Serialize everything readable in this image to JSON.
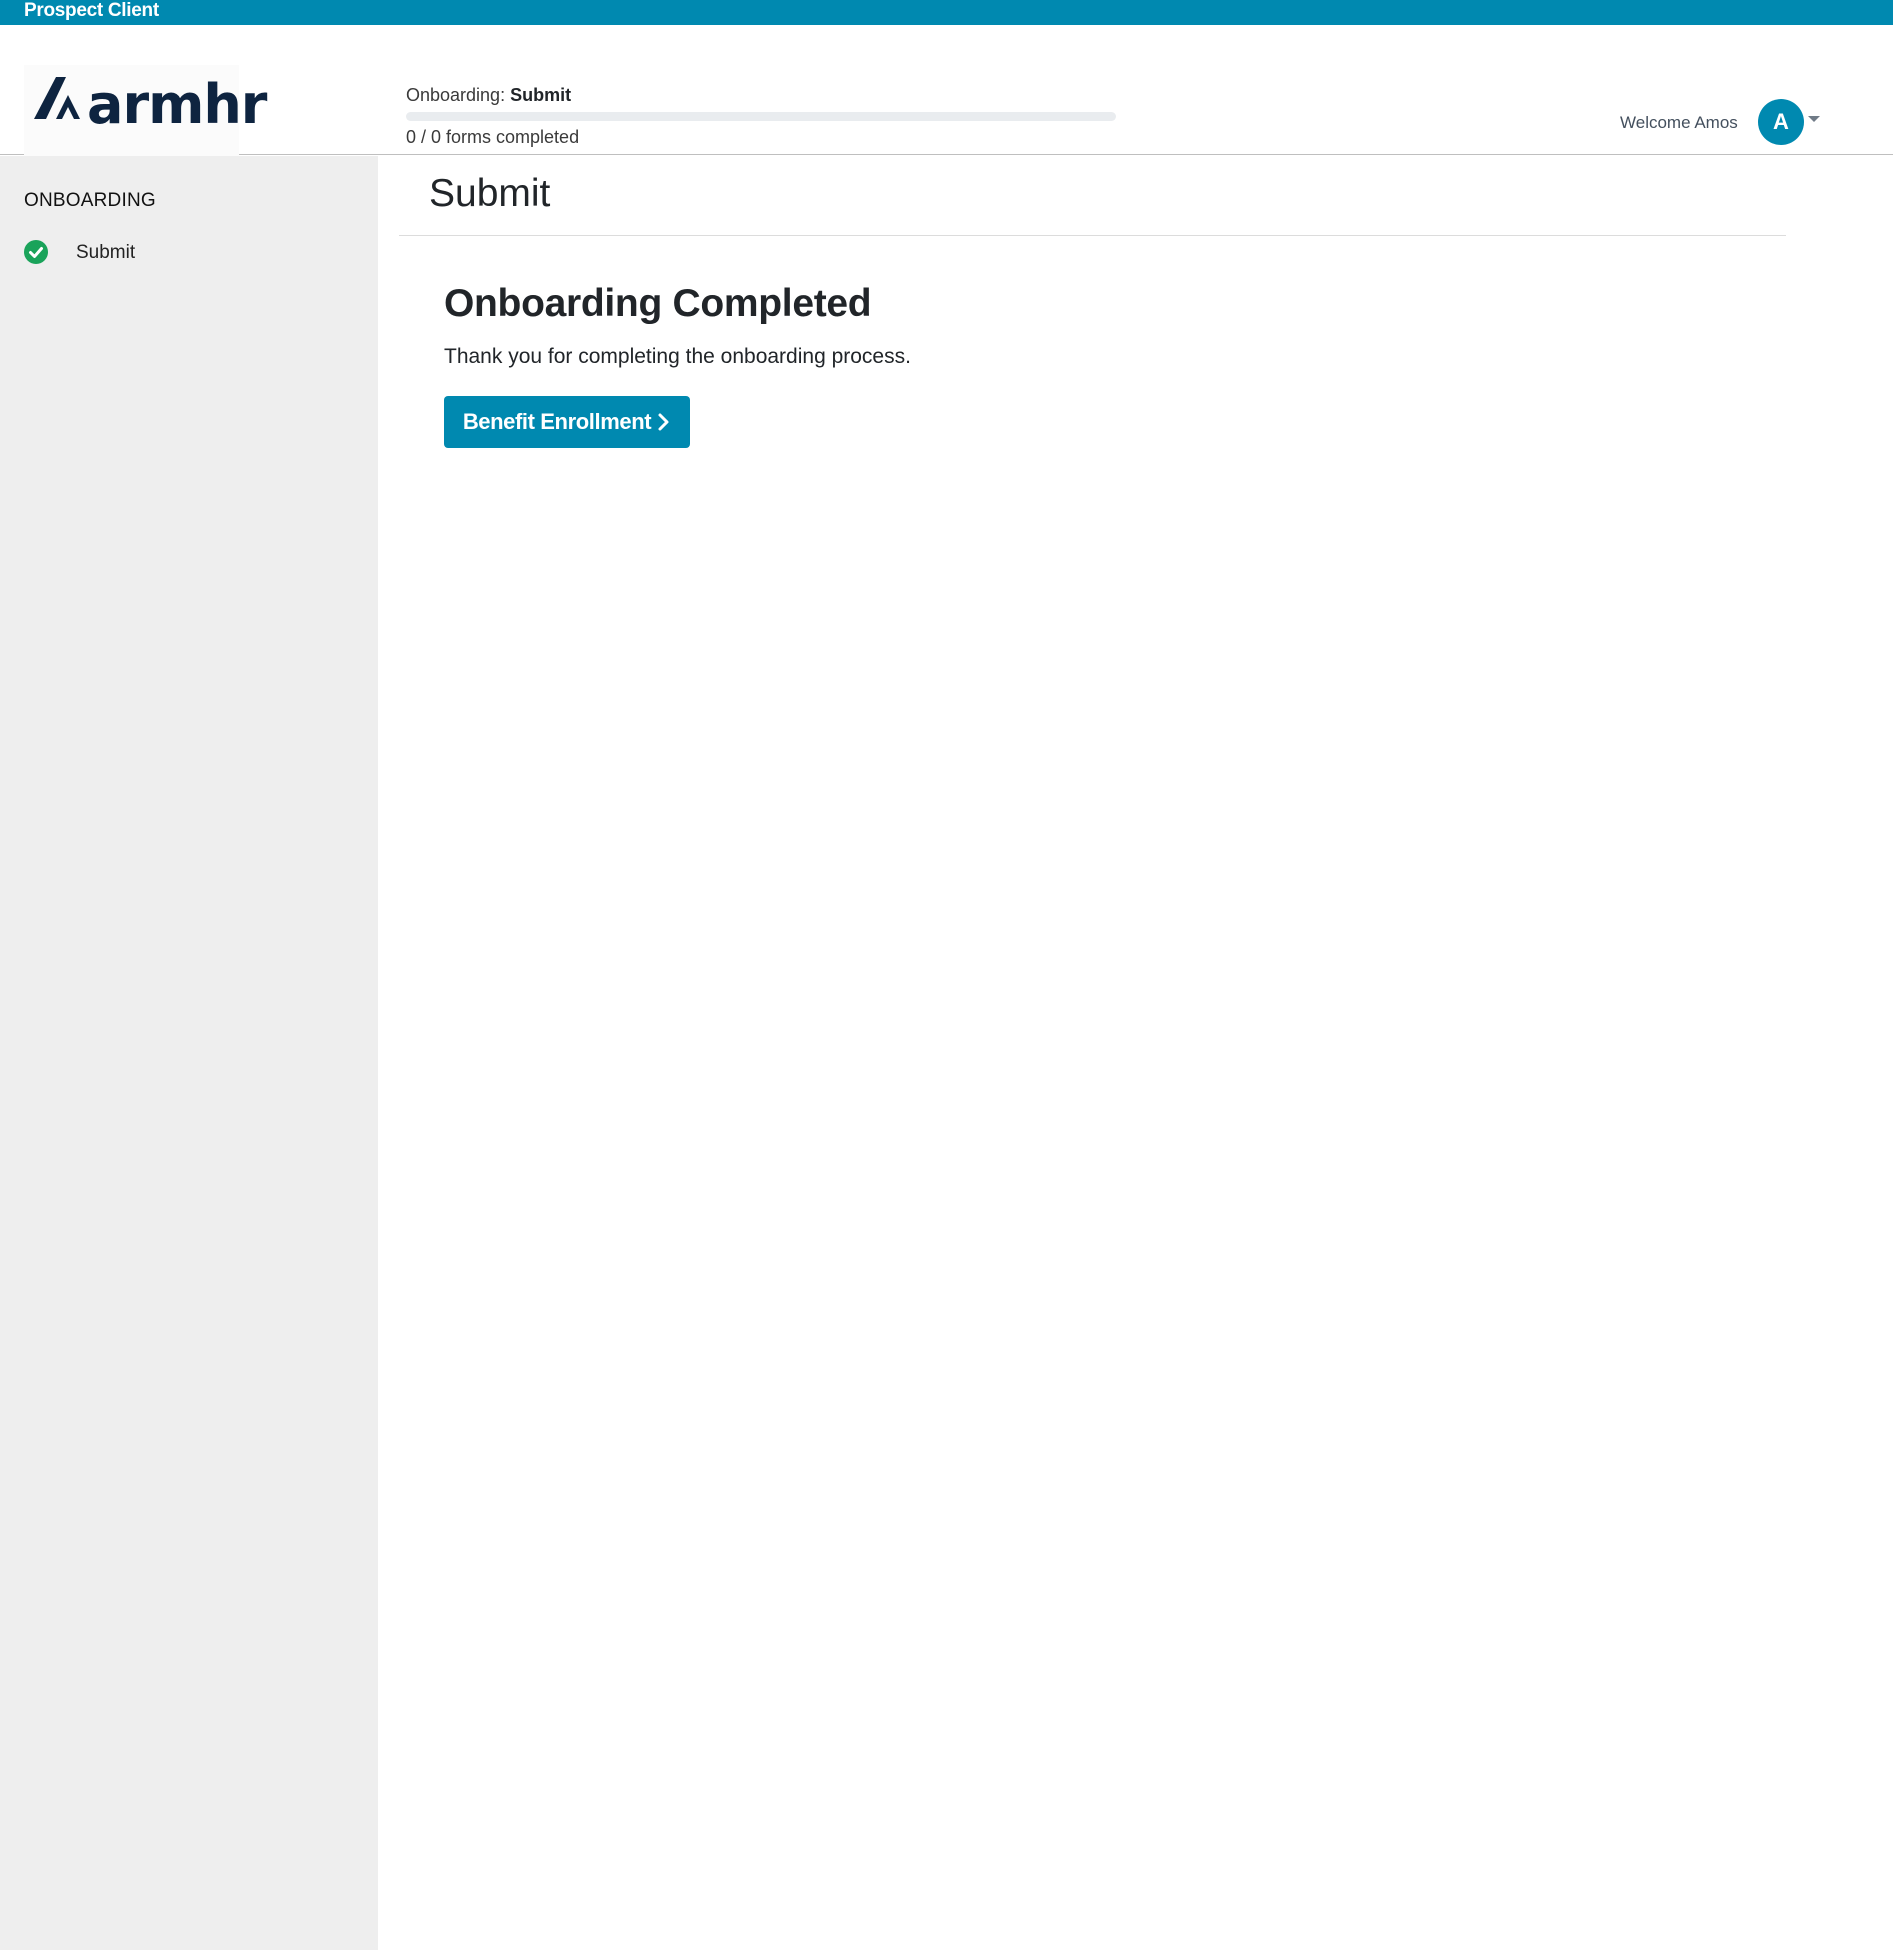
{
  "topbar": {
    "title": "Prospect Client"
  },
  "header": {
    "logo_text": "armhr",
    "progress": {
      "label_prefix": "Onboarding:",
      "current_step": "Submit",
      "count_text": "0 / 0 forms completed",
      "fraction": 0
    },
    "welcome_text": "Welcome Amos",
    "avatar_initial": "A"
  },
  "sidebar": {
    "heading": "ONBOARDING",
    "items": [
      {
        "label": "Submit",
        "status": "completed",
        "icon": "check-circle-icon"
      }
    ]
  },
  "main": {
    "title": "Submit",
    "completed_heading": "Onboarding Completed",
    "completed_text": "Thank you for completing the onboarding process.",
    "button_label": "Benefit Enrollment"
  },
  "colors": {
    "brand": "#0089b0",
    "logo_navy": "#0e2440",
    "success": "#1aa35a",
    "sidebar_bg": "#eeeeee"
  }
}
